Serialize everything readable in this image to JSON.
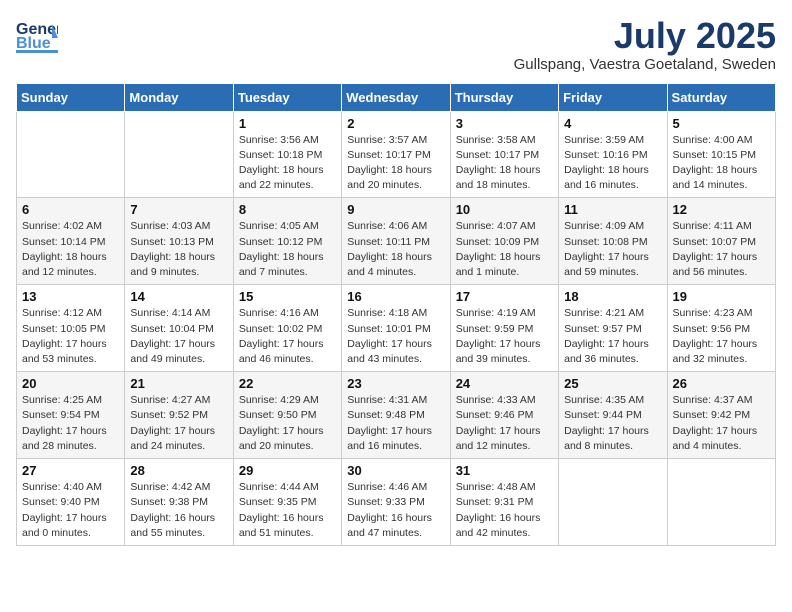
{
  "header": {
    "logo_general": "General",
    "logo_blue": "Blue",
    "month_title": "July 2025",
    "location": "Gullspang, Vaestra Goetaland, Sweden"
  },
  "weekdays": [
    "Sunday",
    "Monday",
    "Tuesday",
    "Wednesday",
    "Thursday",
    "Friday",
    "Saturday"
  ],
  "weeks": [
    [
      {
        "day": "",
        "info": ""
      },
      {
        "day": "",
        "info": ""
      },
      {
        "day": "1",
        "info": "Sunrise: 3:56 AM\nSunset: 10:18 PM\nDaylight: 18 hours\nand 22 minutes."
      },
      {
        "day": "2",
        "info": "Sunrise: 3:57 AM\nSunset: 10:17 PM\nDaylight: 18 hours\nand 20 minutes."
      },
      {
        "day": "3",
        "info": "Sunrise: 3:58 AM\nSunset: 10:17 PM\nDaylight: 18 hours\nand 18 minutes."
      },
      {
        "day": "4",
        "info": "Sunrise: 3:59 AM\nSunset: 10:16 PM\nDaylight: 18 hours\nand 16 minutes."
      },
      {
        "day": "5",
        "info": "Sunrise: 4:00 AM\nSunset: 10:15 PM\nDaylight: 18 hours\nand 14 minutes."
      }
    ],
    [
      {
        "day": "6",
        "info": "Sunrise: 4:02 AM\nSunset: 10:14 PM\nDaylight: 18 hours\nand 12 minutes."
      },
      {
        "day": "7",
        "info": "Sunrise: 4:03 AM\nSunset: 10:13 PM\nDaylight: 18 hours\nand 9 minutes."
      },
      {
        "day": "8",
        "info": "Sunrise: 4:05 AM\nSunset: 10:12 PM\nDaylight: 18 hours\nand 7 minutes."
      },
      {
        "day": "9",
        "info": "Sunrise: 4:06 AM\nSunset: 10:11 PM\nDaylight: 18 hours\nand 4 minutes."
      },
      {
        "day": "10",
        "info": "Sunrise: 4:07 AM\nSunset: 10:09 PM\nDaylight: 18 hours\nand 1 minute."
      },
      {
        "day": "11",
        "info": "Sunrise: 4:09 AM\nSunset: 10:08 PM\nDaylight: 17 hours\nand 59 minutes."
      },
      {
        "day": "12",
        "info": "Sunrise: 4:11 AM\nSunset: 10:07 PM\nDaylight: 17 hours\nand 56 minutes."
      }
    ],
    [
      {
        "day": "13",
        "info": "Sunrise: 4:12 AM\nSunset: 10:05 PM\nDaylight: 17 hours\nand 53 minutes."
      },
      {
        "day": "14",
        "info": "Sunrise: 4:14 AM\nSunset: 10:04 PM\nDaylight: 17 hours\nand 49 minutes."
      },
      {
        "day": "15",
        "info": "Sunrise: 4:16 AM\nSunset: 10:02 PM\nDaylight: 17 hours\nand 46 minutes."
      },
      {
        "day": "16",
        "info": "Sunrise: 4:18 AM\nSunset: 10:01 PM\nDaylight: 17 hours\nand 43 minutes."
      },
      {
        "day": "17",
        "info": "Sunrise: 4:19 AM\nSunset: 9:59 PM\nDaylight: 17 hours\nand 39 minutes."
      },
      {
        "day": "18",
        "info": "Sunrise: 4:21 AM\nSunset: 9:57 PM\nDaylight: 17 hours\nand 36 minutes."
      },
      {
        "day": "19",
        "info": "Sunrise: 4:23 AM\nSunset: 9:56 PM\nDaylight: 17 hours\nand 32 minutes."
      }
    ],
    [
      {
        "day": "20",
        "info": "Sunrise: 4:25 AM\nSunset: 9:54 PM\nDaylight: 17 hours\nand 28 minutes."
      },
      {
        "day": "21",
        "info": "Sunrise: 4:27 AM\nSunset: 9:52 PM\nDaylight: 17 hours\nand 24 minutes."
      },
      {
        "day": "22",
        "info": "Sunrise: 4:29 AM\nSunset: 9:50 PM\nDaylight: 17 hours\nand 20 minutes."
      },
      {
        "day": "23",
        "info": "Sunrise: 4:31 AM\nSunset: 9:48 PM\nDaylight: 17 hours\nand 16 minutes."
      },
      {
        "day": "24",
        "info": "Sunrise: 4:33 AM\nSunset: 9:46 PM\nDaylight: 17 hours\nand 12 minutes."
      },
      {
        "day": "25",
        "info": "Sunrise: 4:35 AM\nSunset: 9:44 PM\nDaylight: 17 hours\nand 8 minutes."
      },
      {
        "day": "26",
        "info": "Sunrise: 4:37 AM\nSunset: 9:42 PM\nDaylight: 17 hours\nand 4 minutes."
      }
    ],
    [
      {
        "day": "27",
        "info": "Sunrise: 4:40 AM\nSunset: 9:40 PM\nDaylight: 17 hours\nand 0 minutes."
      },
      {
        "day": "28",
        "info": "Sunrise: 4:42 AM\nSunset: 9:38 PM\nDaylight: 16 hours\nand 55 minutes."
      },
      {
        "day": "29",
        "info": "Sunrise: 4:44 AM\nSunset: 9:35 PM\nDaylight: 16 hours\nand 51 minutes."
      },
      {
        "day": "30",
        "info": "Sunrise: 4:46 AM\nSunset: 9:33 PM\nDaylight: 16 hours\nand 47 minutes."
      },
      {
        "day": "31",
        "info": "Sunrise: 4:48 AM\nSunset: 9:31 PM\nDaylight: 16 hours\nand 42 minutes."
      },
      {
        "day": "",
        "info": ""
      },
      {
        "day": "",
        "info": ""
      }
    ]
  ]
}
